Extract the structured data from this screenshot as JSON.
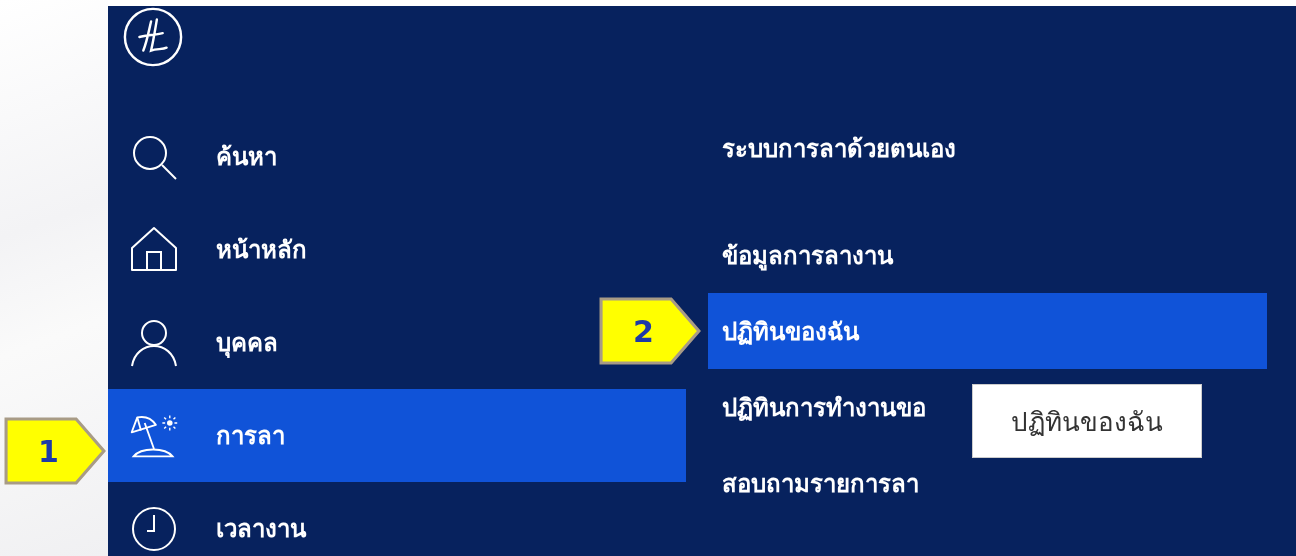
{
  "main_menu": [
    {
      "label": "ค้นหา",
      "kind": "search",
      "selected": false
    },
    {
      "label": "หน้าหลัก",
      "kind": "home",
      "selected": false
    },
    {
      "label": "บุคคล",
      "kind": "person",
      "selected": false
    },
    {
      "label": "การลา",
      "kind": "leave",
      "selected": true
    },
    {
      "label": "เวลางาน",
      "kind": "clock",
      "selected": false
    }
  ],
  "submenu": {
    "title": "ระบบการลาด้วยตนเอง",
    "items": [
      {
        "label": "ข้อมูลการลางาน",
        "selected": false
      },
      {
        "label": "ปฏิทินของฉัน",
        "selected": true
      },
      {
        "label": "ปฏิทินการทำงานขอ",
        "selected": false
      },
      {
        "label": "สอบถามรายการลา",
        "selected": false
      }
    ]
  },
  "tooltip": "ปฏิทินของฉัน",
  "callouts": [
    "1",
    "2"
  ]
}
